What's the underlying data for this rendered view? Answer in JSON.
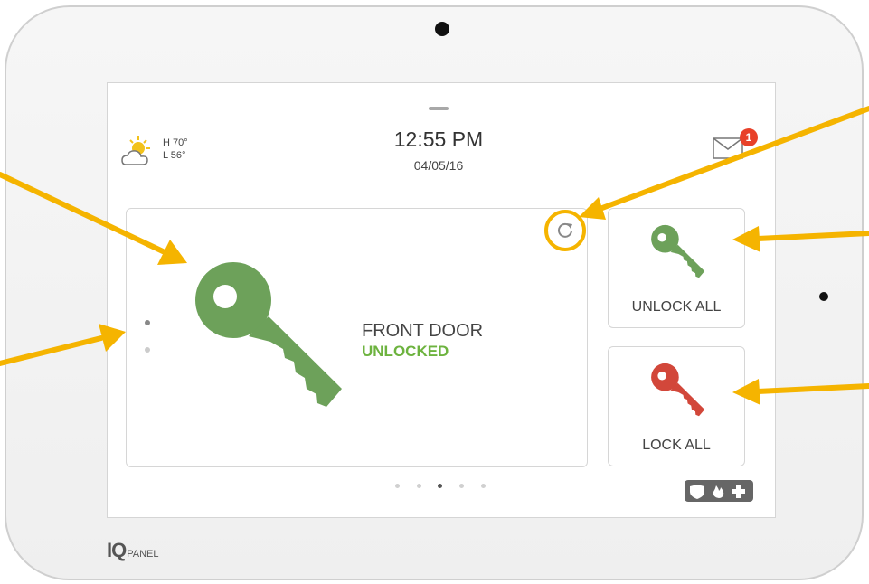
{
  "weather": {
    "high": "H 70°",
    "low": "L 56°"
  },
  "clock": {
    "time": "12:55 PM",
    "date": "04/05/16"
  },
  "messages": {
    "badge_count": "1"
  },
  "lock_card": {
    "device_name": "FRONT DOOR",
    "status": "UNLOCKED"
  },
  "actions": {
    "unlock_all": "UNLOCK ALL",
    "lock_all": "LOCK ALL"
  },
  "pager": {
    "count": 5,
    "active_index": 2
  },
  "brand": {
    "iq": "IQ",
    "panel": "PANEL"
  },
  "icons": {
    "weather": "partly-cloudy-icon",
    "mail": "envelope-icon",
    "refresh": "refresh-icon",
    "key": "key-icon",
    "emergency": [
      "shield-icon",
      "fire-icon",
      "medical-cross-icon"
    ]
  },
  "colors": {
    "unlocked_green": "#6DA15A",
    "locked_red": "#D2473A",
    "status_text_green": "#6DB33F",
    "annotation_orange": "#F5B400",
    "badge_red": "#E8412A"
  }
}
